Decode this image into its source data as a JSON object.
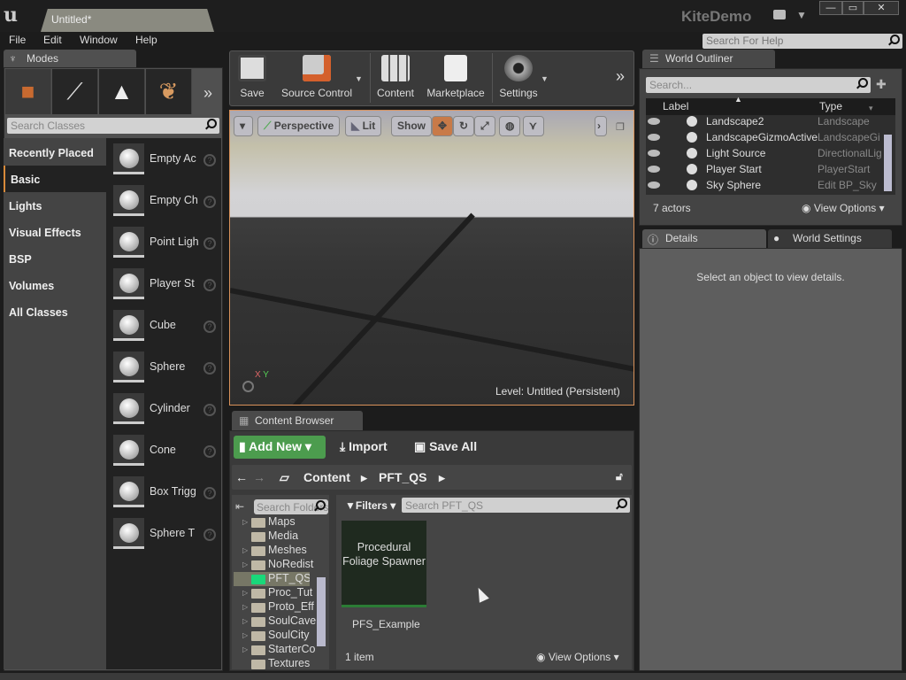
{
  "window": {
    "doc_tab": "Untitled*",
    "app_title": "KiteDemo",
    "min": "—",
    "max": "▭",
    "close": "✕"
  },
  "menu": {
    "items": [
      "File",
      "Edit",
      "Window",
      "Help"
    ],
    "help_search_placeholder": "Search For Help"
  },
  "modes": {
    "tab_label": "Modes",
    "mode_icons": [
      "place-icon",
      "paint-icon",
      "landscape-icon",
      "foliage-icon"
    ],
    "search_placeholder": "Search Classes",
    "categories": [
      "Recently Placed",
      "Basic",
      "Lights",
      "Visual Effects",
      "BSP",
      "Volumes",
      "All Classes"
    ],
    "active_category": "Basic",
    "classes": [
      "Empty Ac",
      "Empty Ch",
      "Point Ligh",
      "Player St",
      "Cube",
      "Sphere",
      "Cylinder",
      "Cone",
      "Box Trigg",
      "Sphere T"
    ]
  },
  "toolbar": {
    "buttons": [
      "Save",
      "Source Control",
      "Content",
      "Marketplace",
      "Settings"
    ]
  },
  "viewport": {
    "perspective": "Perspective",
    "lit": "Lit",
    "show": "Show",
    "level": "Level:  Untitled (Persistent)",
    "axis_x": "X",
    "axis_y": "Y"
  },
  "outliner": {
    "tab_label": "World Outliner",
    "search_placeholder": "Search...",
    "col_label": "Label",
    "col_type": "Type",
    "rows": [
      {
        "label": "Landscape2",
        "type": "Landscape"
      },
      {
        "label": "LandscapeGizmoActive",
        "type": "LandscapeGi"
      },
      {
        "label": "Light Source",
        "type": "DirectionalLig"
      },
      {
        "label": "Player Start",
        "type": "PlayerStart"
      },
      {
        "label": "Sky Sphere",
        "type": "Edit BP_Sky"
      }
    ],
    "actor_count": "7 actors",
    "view_options": "View Options"
  },
  "details": {
    "tab_label": "Details",
    "world_settings_label": "World Settings",
    "empty_message": "Select an object to view details."
  },
  "content_browser": {
    "tab_label": "Content Browser",
    "add_new": "Add New",
    "import": "Import",
    "save_all": "Save All",
    "path": [
      "Content",
      "PFT_QS"
    ],
    "folder_search_placeholder": "Search Folders",
    "folders": [
      {
        "name": "Maps",
        "expandable": true
      },
      {
        "name": "Media",
        "expandable": false
      },
      {
        "name": "Meshes",
        "expandable": true
      },
      {
        "name": "NoRedist",
        "expandable": true
      },
      {
        "name": "PFT_QS",
        "expandable": false,
        "selected": true
      },
      {
        "name": "Proc_Tut",
        "expandable": true
      },
      {
        "name": "Proto_Eff",
        "expandable": true
      },
      {
        "name": "SoulCave",
        "expandable": true
      },
      {
        "name": "SoulCity",
        "expandable": true
      },
      {
        "name": "StarterCo",
        "expandable": true
      },
      {
        "name": "Textures",
        "expandable": false
      }
    ],
    "filters": "Filters",
    "asset_search_placeholder": "Search PFT_QS",
    "asset_tile_text": "Procedural Foliage Spawner",
    "asset_name": "PFS_Example",
    "item_count": "1 item",
    "view_options": "View Options"
  },
  "colors": {
    "accent_orange": "#d8915a",
    "add_new_green": "#4c9c4e",
    "selected_folder": "#19d87a"
  }
}
